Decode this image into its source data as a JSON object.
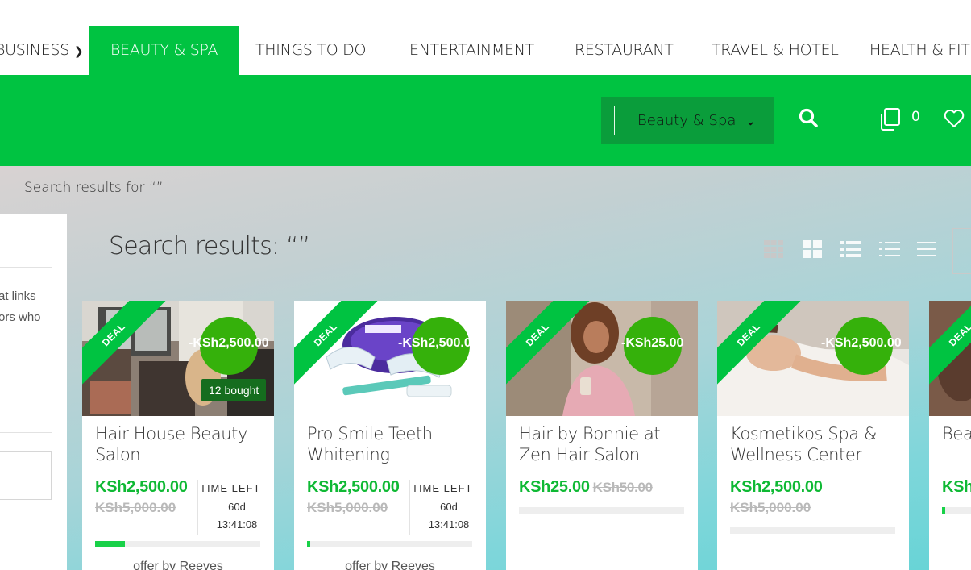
{
  "nav": {
    "items": [
      {
        "label": "BUSINESS",
        "has_dropdown": true
      },
      {
        "label": "BEAUTY & SPA",
        "active": true
      },
      {
        "label": "THINGS TO DO"
      },
      {
        "label": "ENTERTAINMENT"
      },
      {
        "label": "RESTAURANT"
      },
      {
        "label": "TRAVEL & HOTEL"
      },
      {
        "label": "HEALTH & FITN"
      }
    ]
  },
  "header": {
    "category_select": "Beauty & Spa",
    "compare_count": "0",
    "icons": [
      "search-icon",
      "compare-icon",
      "heart-icon"
    ]
  },
  "breadcrumb": "Search results for “”",
  "sidebar": {
    "text_line1": "at links",
    "text_line2": "ors who"
  },
  "results_title": "Search results: “”",
  "view_modes": [
    "grid-small-icon",
    "grid-large-icon",
    "list-icon",
    "list-compact-icon",
    "list-plain-icon"
  ],
  "colors": {
    "brand_green": "#00c341",
    "price_green": "#0fb934",
    "badge_green": "#35b10b"
  },
  "deals": [
    {
      "ribbon": "DEAL",
      "discount": "-KSh2,500.00",
      "bought": "12 bought",
      "title": "Hair House Beauty Salon",
      "price": "KSh2,500.00",
      "old_price": "KSh5,000.00",
      "time_left_label": "TIME LEFT",
      "days": "60d",
      "time": "13:41:08",
      "progress": 0.18,
      "offer": "offer by Reeves"
    },
    {
      "ribbon": "DEAL",
      "discount": "-KSh2,500.00",
      "title": "Pro Smile Teeth Whitening",
      "price": "KSh2,500.00",
      "old_price": "KSh5,000.00",
      "time_left_label": "TIME LEFT",
      "days": "60d",
      "time": "13:41:08",
      "progress": 0.02,
      "offer": "offer by Reeves"
    },
    {
      "ribbon": "DEAL",
      "discount": "-KSh25.00",
      "title": "Hair by Bonnie at Zen Hair Salon",
      "price": "KSh25.00",
      "old_price": "KSh50.00",
      "progress": 0.0
    },
    {
      "ribbon": "DEAL",
      "discount": "-KSh2,500.00",
      "title": "Kosmetikos Spa & Wellness Center",
      "price": "KSh2,500.00",
      "old_price": "KSh5,000.00",
      "progress": 0.0
    },
    {
      "ribbon": "DEAL",
      "title": "Beauty & Wellness",
      "price": "KSh",
      "progress": 0.02
    }
  ]
}
